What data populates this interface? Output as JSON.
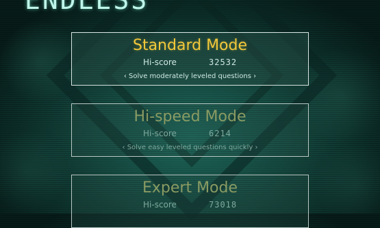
{
  "screen": {
    "title": "ENDLESS"
  },
  "modes": [
    {
      "name": "Standard Mode",
      "hiscore_label": "Hi-score",
      "hiscore": "32532",
      "description": "‹ Solve moderately leveled questions ›",
      "state": "selected"
    },
    {
      "name": "Hi-speed Mode",
      "hiscore_label": "Hi-score",
      "hiscore": "6214",
      "description": "‹ Solve easy leveled questions quickly ›",
      "state": "unselected"
    },
    {
      "name": "Expert Mode",
      "hiscore_label": "Hi-score",
      "hiscore": "73018",
      "description": "",
      "state": "unselected"
    }
  ],
  "colors": {
    "selected_title": "#f2c83a",
    "unselected_title": "#8a9b63",
    "text": "#cfe9e3",
    "card_border": "#d8e6e2",
    "background": "#15483f"
  }
}
